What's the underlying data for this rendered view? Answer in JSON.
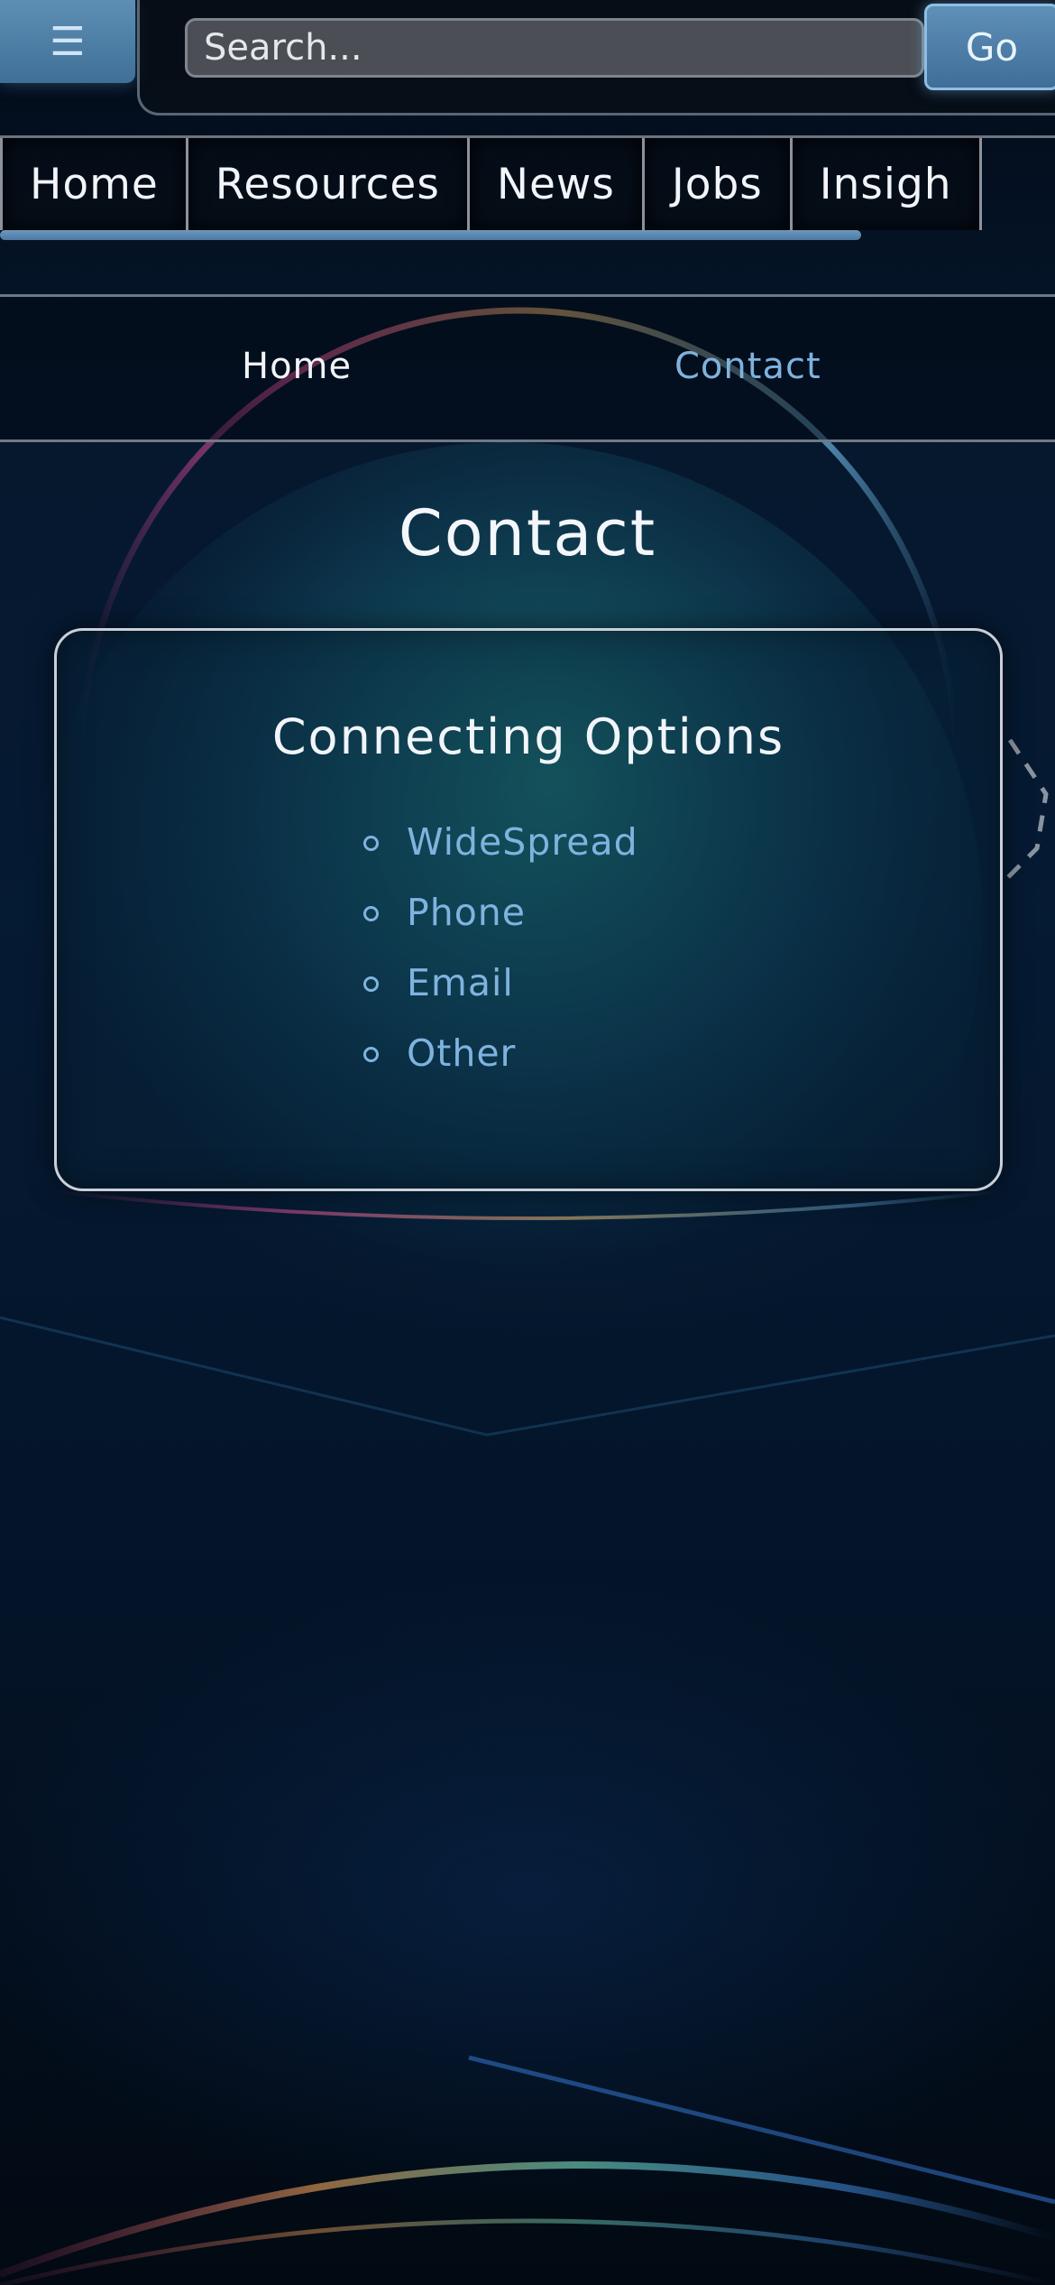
{
  "header": {
    "menu_icon": "hamburger-menu-icon",
    "search_placeholder": "Search...",
    "go_label": "Go"
  },
  "nav": {
    "tabs": [
      {
        "label": "Home"
      },
      {
        "label": "Resources"
      },
      {
        "label": "News"
      },
      {
        "label": "Jobs"
      },
      {
        "label": "Insigh"
      }
    ]
  },
  "breadcrumb": {
    "home": "Home",
    "current": "Contact"
  },
  "main": {
    "title": "Contact",
    "card_title": "Connecting Options",
    "options": [
      {
        "label": "WideSpread"
      },
      {
        "label": "Phone"
      },
      {
        "label": "Email"
      },
      {
        "label": "Other"
      }
    ]
  },
  "colors": {
    "accent": "#7fb3df",
    "button": "#4f7fa8"
  }
}
